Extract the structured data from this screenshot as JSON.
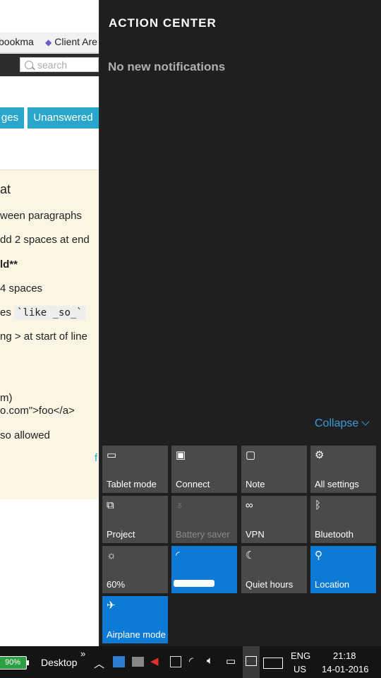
{
  "browser": {
    "bookmarks": [
      "bookma",
      "Client Are"
    ],
    "search_placeholder": "search",
    "tabs": [
      "ges",
      "Unanswered"
    ],
    "help_lines": [
      "at",
      "ween paragraphs",
      "dd 2 spaces at end",
      "ld**",
      " 4 spaces",
      "es",
      "`like _so_`",
      "ng > at start of line",
      "m)",
      "o.com\">foo</a>",
      "so allowed"
    ],
    "trailing_char": "f"
  },
  "action_center": {
    "title": "ACTION CENTER",
    "empty_message": "No new notifications",
    "collapse_label": "Collapse",
    "tiles": [
      {
        "label": "Tablet mode",
        "icon": "tablet-icon",
        "state": "off"
      },
      {
        "label": "Connect",
        "icon": "connect-icon",
        "state": "off"
      },
      {
        "label": "Note",
        "icon": "note-icon",
        "state": "off"
      },
      {
        "label": "All settings",
        "icon": "gear-icon",
        "state": "off"
      },
      {
        "label": "Project",
        "icon": "project-icon",
        "state": "off"
      },
      {
        "label": "Battery saver",
        "icon": "battery-saver-icon",
        "state": "disabled"
      },
      {
        "label": "VPN",
        "icon": "vpn-icon",
        "state": "off"
      },
      {
        "label": "Bluetooth",
        "icon": "bluetooth-icon",
        "state": "off"
      },
      {
        "label": "60%",
        "icon": "brightness-icon",
        "state": "off"
      },
      {
        "label": "",
        "icon": "wifi-icon",
        "state": "on"
      },
      {
        "label": "Quiet hours",
        "icon": "moon-icon",
        "state": "off"
      },
      {
        "label": "Location",
        "icon": "location-icon",
        "state": "on"
      },
      {
        "label": "Airplane mode",
        "icon": "airplane-icon",
        "state": "on"
      }
    ]
  },
  "taskbar": {
    "battery": "90%",
    "desktop_label": "Desktop",
    "more_chevron": "»",
    "language_line1": "ENG",
    "language_line2": "US",
    "time": "21:18",
    "date": "14-01-2016"
  },
  "colors": {
    "accent": "#0d7ad6",
    "tile": "#4a4a4a",
    "collapse": "#3c9bd8",
    "tab": "#29a6cc"
  }
}
